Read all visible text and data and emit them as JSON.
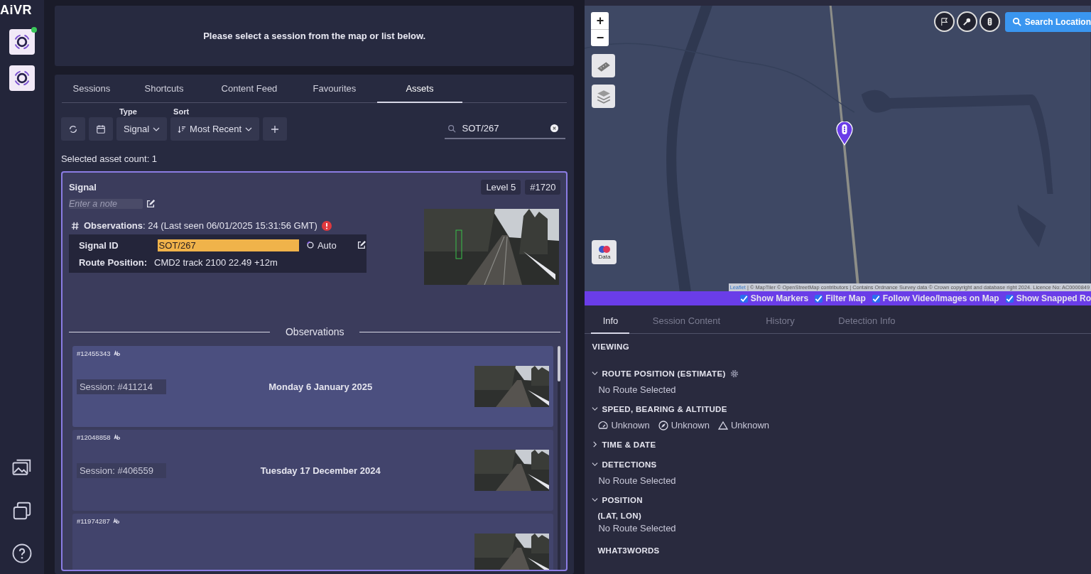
{
  "logo": "AiVR",
  "sidebar": {
    "apps": [
      {
        "online": true
      },
      {
        "online": false
      }
    ]
  },
  "banner": {
    "message": "Please select a session from the map or list below."
  },
  "tabs": [
    {
      "label": "Sessions",
      "selected": false
    },
    {
      "label": "Shortcuts",
      "selected": false
    },
    {
      "label": "Content Feed",
      "selected": false
    },
    {
      "label": "Favourites",
      "selected": false
    },
    {
      "label": "Assets",
      "selected": true
    }
  ],
  "toolbar": {
    "type_label": "Type",
    "type_value": "Signal",
    "sort_label": "Sort",
    "sort_value": "Most Recent",
    "search": {
      "value": "SOT/267"
    }
  },
  "selected_count": "Selected asset count: 1",
  "asset": {
    "title": "Signal",
    "badges": [
      "Level 5",
      "#1720"
    ],
    "note": {
      "placeholder": "Enter a note"
    },
    "observations": "**Observations**: 24 (Last seen 06/01/2025 15:31:56 GMT)",
    "warning": true,
    "fields": [
      {
        "label": "Signal ID",
        "value": "SOT/267",
        "highlighted": true
      },
      {
        "label": "Route Position:",
        "value": "CMD2 track 2100 22.49 +12m",
        "highlighted": false
      }
    ],
    "mode": "Auto"
  },
  "observations": {
    "heading": "Observations",
    "items": [
      {
        "id": "#12455343",
        "session": "Session: #411214",
        "date": "Monday 6 January 2025",
        "hovered": true
      },
      {
        "id": "#12048858",
        "session": "Session: #406559",
        "date": "Tuesday 17 December 2024",
        "hovered": false
      },
      {
        "id": "#11974287",
        "hovered": false
      }
    ]
  },
  "map": {
    "zoom_in": "+",
    "zoom_out": "−",
    "data_button": "Data",
    "search_button": "Search Location",
    "attribution_link": "Leaflet",
    "attribution": "| © MapTiler © OpenStreetMap contributors | Contains Ordnance Survey data © Crown copyright and database right 2024. Licence No: AC0000849",
    "options": [
      {
        "label": "Show Markers",
        "checked": true
      },
      {
        "label": "Filter Map",
        "checked": true
      },
      {
        "label": "Follow Video/Images on Map",
        "checked": true
      },
      {
        "label": "Show Snapped Ro",
        "checked": true
      }
    ]
  },
  "info_tabs": [
    {
      "label": "Info",
      "selected": true
    },
    {
      "label": "Session Content",
      "selected": false
    },
    {
      "label": "History",
      "selected": false
    },
    {
      "label": "Detection Info",
      "selected": false
    }
  ],
  "info": {
    "heading": "VIEWING",
    "sections": [
      {
        "title": "ROUTE POSITION (ESTIMATE)",
        "expanded": true,
        "settings": true,
        "text": "No Route Selected"
      },
      {
        "title": "SPEED, BEARING & ALTITUDE",
        "expanded": true,
        "settings": false,
        "readings": [
          {
            "kind": "speed",
            "value": "Unknown"
          },
          {
            "kind": "bearing",
            "value": "Unknown"
          },
          {
            "kind": "altitude",
            "value": "Unknown"
          }
        ]
      },
      {
        "title": "TIME & DATE",
        "expanded": false,
        "settings": false
      },
      {
        "title": "DETECTIONS",
        "expanded": true,
        "settings": false,
        "text": "No Route Selected"
      },
      {
        "title": "POSITION",
        "expanded": true,
        "settings": false,
        "fields": [
          {
            "label": "(LAT, LON)",
            "value": "No Route Selected"
          },
          {
            "label": "WHAT3WORDS"
          }
        ]
      }
    ]
  }
}
